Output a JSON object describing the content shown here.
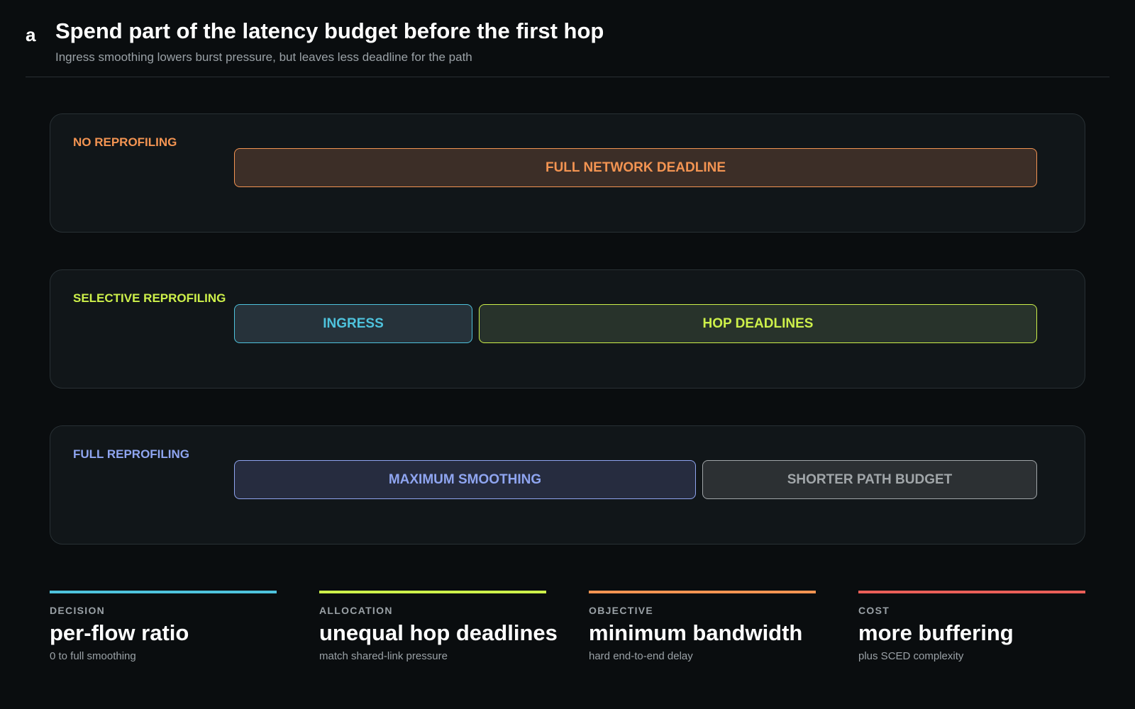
{
  "header": {
    "panel_letter": "a",
    "title": "Spend part of the latency budget before the first hop",
    "subtitle": "Ingress smoothing lowers burst pressure, but leaves less deadline for the path"
  },
  "rows": [
    {
      "label": "NO REPROFILING",
      "label_color": "#f39452",
      "segments": [
        {
          "label": "FULL NETWORK DEADLINE",
          "color": "#f39452",
          "fill": "#3c2e27"
        }
      ]
    },
    {
      "label": "SELECTIVE REPROFILING",
      "label_color": "#cdf04a",
      "segments": [
        {
          "label": "INGRESS",
          "color": "#4ec3dd",
          "fill": "#26323a"
        },
        {
          "label": "HOP DEADLINES",
          "color": "#cdf04a",
          "fill": "#28332b"
        }
      ]
    },
    {
      "label": "FULL REPROFILING",
      "label_color": "#8fa5f0",
      "segments": [
        {
          "label": "MAXIMUM SMOOTHING",
          "color": "#8fa5f0",
          "fill": "#262c3f"
        },
        {
          "label": "SHORTER PATH BUDGET",
          "color": "#a1a6a9",
          "fill": "#2c3033"
        }
      ]
    }
  ],
  "metrics": [
    {
      "category": "DECISION",
      "value": "per-flow ratio",
      "sub": "0 to full smoothing",
      "color": "#4ec3dd"
    },
    {
      "category": "ALLOCATION",
      "value": "unequal hop deadlines",
      "sub": "match shared-link pressure",
      "color": "#cdf04a"
    },
    {
      "category": "OBJECTIVE",
      "value": "minimum bandwidth",
      "sub": "hard end-to-end delay",
      "color": "#f39452"
    },
    {
      "category": "COST",
      "value": "more buffering",
      "sub": "plus SCED complexity",
      "color": "#eb5f58"
    }
  ]
}
